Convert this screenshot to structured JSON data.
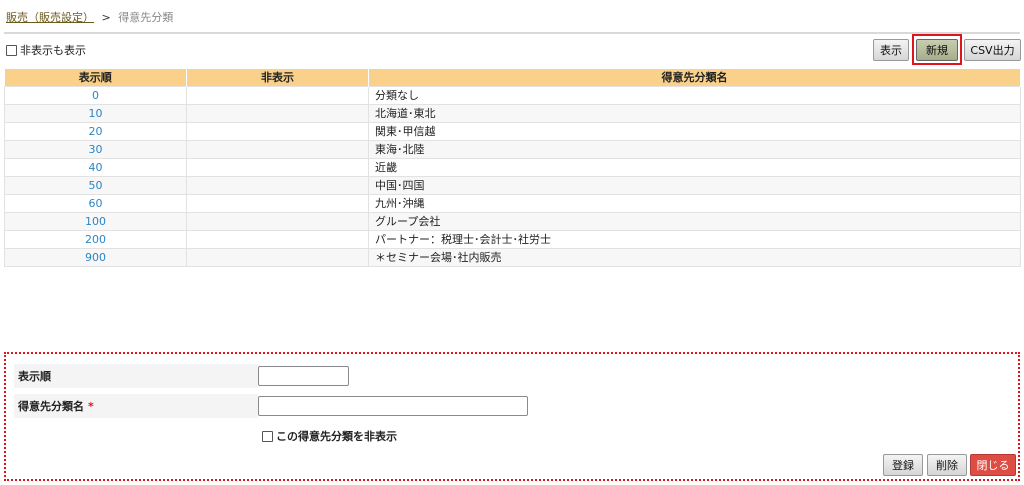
{
  "breadcrumb": {
    "parent": "販売（販売設定）",
    "separator": ">",
    "current": "得意先分類"
  },
  "filter": {
    "show_hidden_label": "非表示も表示",
    "show_hidden_checked": false
  },
  "toolbar": {
    "display_label": "表示",
    "new_label": "新規",
    "csv_label": "CSV出力"
  },
  "table": {
    "headers": [
      "表示順",
      "非表示",
      "得意先分類名"
    ],
    "rows": [
      {
        "order": "0",
        "hidden": "",
        "name": "分類なし"
      },
      {
        "order": "10",
        "hidden": "",
        "name": "北海道･東北"
      },
      {
        "order": "20",
        "hidden": "",
        "name": "関東･甲信越"
      },
      {
        "order": "30",
        "hidden": "",
        "name": "東海･北陸"
      },
      {
        "order": "40",
        "hidden": "",
        "name": "近畿"
      },
      {
        "order": "50",
        "hidden": "",
        "name": "中国･四国"
      },
      {
        "order": "60",
        "hidden": "",
        "name": "九州･沖縄"
      },
      {
        "order": "100",
        "hidden": "",
        "name": "グループ会社"
      },
      {
        "order": "200",
        "hidden": "",
        "name": "パートナー：税理士･会計士･社労士"
      },
      {
        "order": "900",
        "hidden": "",
        "name": "＊セミナー会場･社内販売"
      }
    ]
  },
  "form": {
    "order_label": "表示順",
    "order_value": "",
    "name_label": "得意先分類名",
    "required_mark": "*",
    "name_value": "",
    "hide_label": "この得意先分類を非表示",
    "hide_checked": false,
    "register_label": "登録",
    "delete_label": "削除",
    "close_label": "閉じる"
  },
  "colors": {
    "table_header_bg": "#f9d18b",
    "link_color": "#2a86c5",
    "highlight_red": "#e0141d",
    "close_button_bg": "#de4d43",
    "new_button_bg": "#b8bd9c"
  },
  "icons": [
    "checkbox-icon"
  ]
}
